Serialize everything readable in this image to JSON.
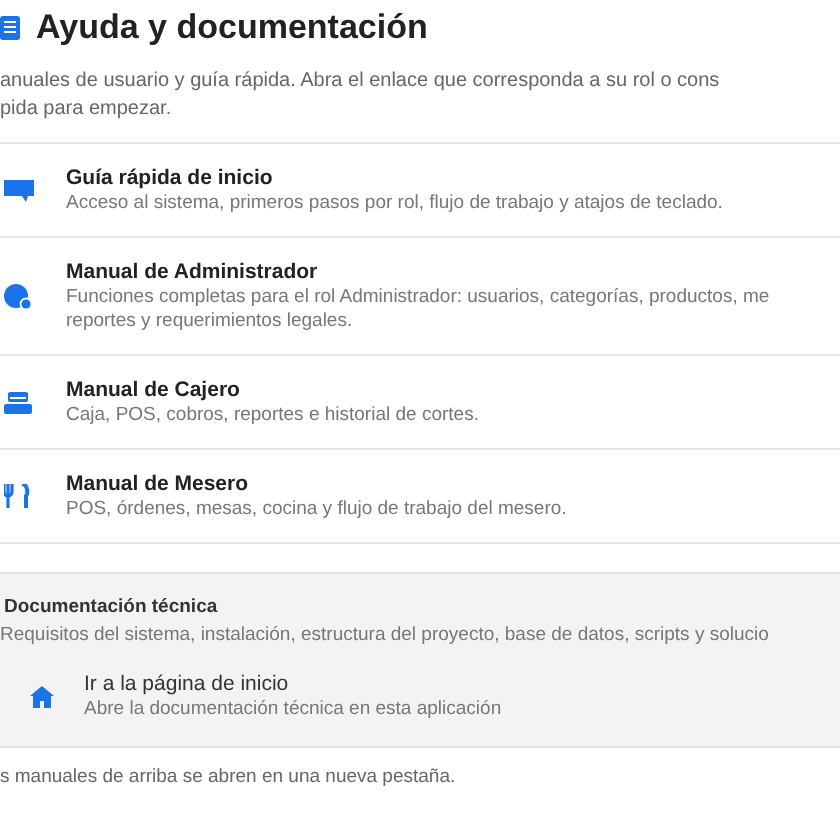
{
  "header": {
    "title": "Ayuda y documentación"
  },
  "intro": [
    "anuales de usuario y guía rápida. Abra el enlace que corresponda a su rol o cons",
    "pida para empezar."
  ],
  "manuals": [
    {
      "kind": "guide",
      "title": "Guía rápida de inicio",
      "description": [
        "Acceso al sistema, primeros pasos por rol, flujo de trabajo y atajos de teclado."
      ]
    },
    {
      "kind": "admin",
      "title": "Manual de Administrador",
      "description": [
        "Funciones completas para el rol Administrador: usuarios, categorías, productos, me",
        "reportes y requerimientos legales."
      ]
    },
    {
      "kind": "cashier",
      "title": "Manual de Cajero",
      "description": [
        "Caja, POS, cobros, reportes e historial de cortes."
      ]
    },
    {
      "kind": "waiter",
      "title": "Manual de Mesero",
      "description": [
        "POS, órdenes, mesas, cocina y flujo de trabajo del mesero."
      ]
    }
  ],
  "technical": {
    "title": "Documentación técnica",
    "description": "Requisitos del sistema, instalación, estructura del proyecto, base de datos, scripts y solucio",
    "link": {
      "title": "Ir a la página de inicio",
      "description": "Abre la documentación técnica en esta aplicación"
    }
  },
  "footer": "s manuales de arriba se abren en una nueva pestaña."
}
